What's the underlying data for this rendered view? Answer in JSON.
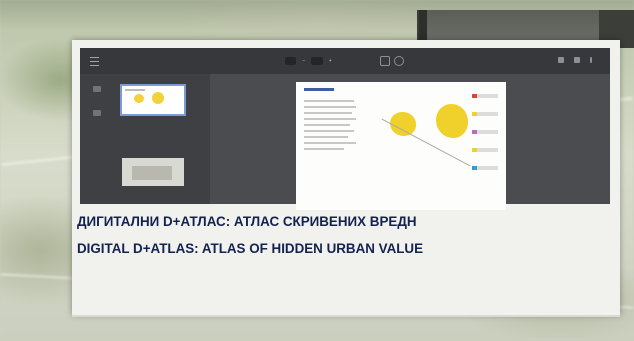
{
  "captions": {
    "line1": "ДИГИТАЛНИ D+АТЛАС: АТЛАС СКРИВЕНИХ ВРЕДН",
    "line2": "DIGITAL D+ATLAS: ATLAS OF HIDDEN URBAN VALUE"
  },
  "colors": {
    "caption": "#14224f",
    "viewer_bg": "#4a4c50",
    "toolbar_bg": "#36383b",
    "map_yellow": "#f0d02a",
    "selected_thumb": "#7a9bd6"
  }
}
